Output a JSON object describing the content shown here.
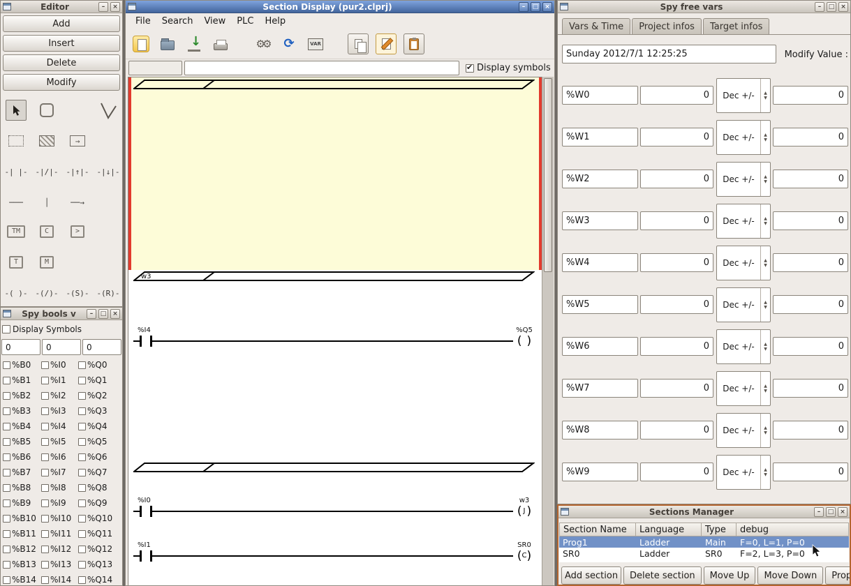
{
  "editor": {
    "title": "Editor",
    "buttons": [
      "Add",
      "Insert",
      "Delete",
      "Modify"
    ],
    "palette": {
      "contacts": [
        "-| |-",
        "-|/|-",
        "-|↑|-",
        "-|↓|-"
      ],
      "wires": [
        "───",
        "│",
        "──→"
      ],
      "blocks_top": [
        "TM",
        "C",
        ">"
      ],
      "blocks_bottom": [
        "T",
        "M"
      ],
      "coils": [
        "-( )-",
        "-(/)-",
        "-(S)-",
        "-(R)-"
      ]
    }
  },
  "spy_bools": {
    "title": "Spy bools v",
    "display_symbols_label": "Display Symbols",
    "counters": [
      "0",
      "0",
      "0"
    ],
    "rows": [
      [
        "%B0",
        "%I0",
        "%Q0"
      ],
      [
        "%B1",
        "%I1",
        "%Q1"
      ],
      [
        "%B2",
        "%I2",
        "%Q2"
      ],
      [
        "%B3",
        "%I3",
        "%Q3"
      ],
      [
        "%B4",
        "%I4",
        "%Q4"
      ],
      [
        "%B5",
        "%I5",
        "%Q5"
      ],
      [
        "%B6",
        "%I6",
        "%Q6"
      ],
      [
        "%B7",
        "%I7",
        "%Q7"
      ],
      [
        "%B8",
        "%I8",
        "%Q8"
      ],
      [
        "%B9",
        "%I9",
        "%Q9"
      ],
      [
        "%B10",
        "%I10",
        "%Q10"
      ],
      [
        "%B11",
        "%I11",
        "%Q11"
      ],
      [
        "%B12",
        "%I12",
        "%Q12"
      ],
      [
        "%B13",
        "%I13",
        "%Q13"
      ],
      [
        "%B14",
        "%I14",
        "%Q14"
      ]
    ]
  },
  "section_display": {
    "title": "Section Display (pur2.clprj)",
    "menus": [
      "File",
      "Search",
      "View",
      "PLC",
      "Help"
    ],
    "toolbar_icons": [
      "new",
      "open",
      "save",
      "print",
      "preferences",
      "refresh",
      "vars",
      "copy",
      "edit",
      "paste"
    ],
    "search_value": "",
    "filter_value": "",
    "display_symbols_label": "Display symbols",
    "ladder": {
      "section_labels": [
        "",
        "w3",
        ""
      ],
      "rungs": [
        {
          "contact": "%I4",
          "coil_label": "%Q5",
          "coil_inner": ""
        },
        {
          "contact": "%I0",
          "coil_label": "w3",
          "coil_inner": "J"
        },
        {
          "contact": "%I1",
          "coil_label": "SR0",
          "coil_inner": "C"
        }
      ]
    }
  },
  "spy_free_vars": {
    "title": "Spy free vars",
    "tabs": [
      "Vars & Time",
      "Project infos",
      "Target infos"
    ],
    "datetime": "Sunday 2012/7/1 12:25:25",
    "modify_value_label": "Modify Value :",
    "rows": [
      {
        "name": "%W0",
        "value": "0",
        "mode": "Dec +/-",
        "modify": "0"
      },
      {
        "name": "%W1",
        "value": "0",
        "mode": "Dec +/-",
        "modify": "0"
      },
      {
        "name": "%W2",
        "value": "0",
        "mode": "Dec +/-",
        "modify": "0"
      },
      {
        "name": "%W3",
        "value": "0",
        "mode": "Dec +/-",
        "modify": "0"
      },
      {
        "name": "%W4",
        "value": "0",
        "mode": "Dec +/-",
        "modify": "0"
      },
      {
        "name": "%W5",
        "value": "0",
        "mode": "Dec +/-",
        "modify": "0"
      },
      {
        "name": "%W6",
        "value": "0",
        "mode": "Dec +/-",
        "modify": "0"
      },
      {
        "name": "%W7",
        "value": "0",
        "mode": "Dec +/-",
        "modify": "0"
      },
      {
        "name": "%W8",
        "value": "0",
        "mode": "Dec +/-",
        "modify": "0"
      },
      {
        "name": "%W9",
        "value": "0",
        "mode": "Dec +/-",
        "modify": "0"
      }
    ]
  },
  "sections_manager": {
    "title": "Sections Manager",
    "columns": [
      "Section Name",
      "Language",
      "Type",
      "debug"
    ],
    "rows": [
      {
        "name": "Prog1",
        "language": "Ladder",
        "type": "Main",
        "debug": "F=0, L=1, P=0"
      },
      {
        "name": "SR0",
        "language": "Ladder",
        "type": "SR0",
        "debug": "F=2, L=3, P=0"
      }
    ],
    "buttons": [
      "Add section",
      "Delete section",
      "Move Up",
      "Move Down",
      "Properties"
    ]
  }
}
